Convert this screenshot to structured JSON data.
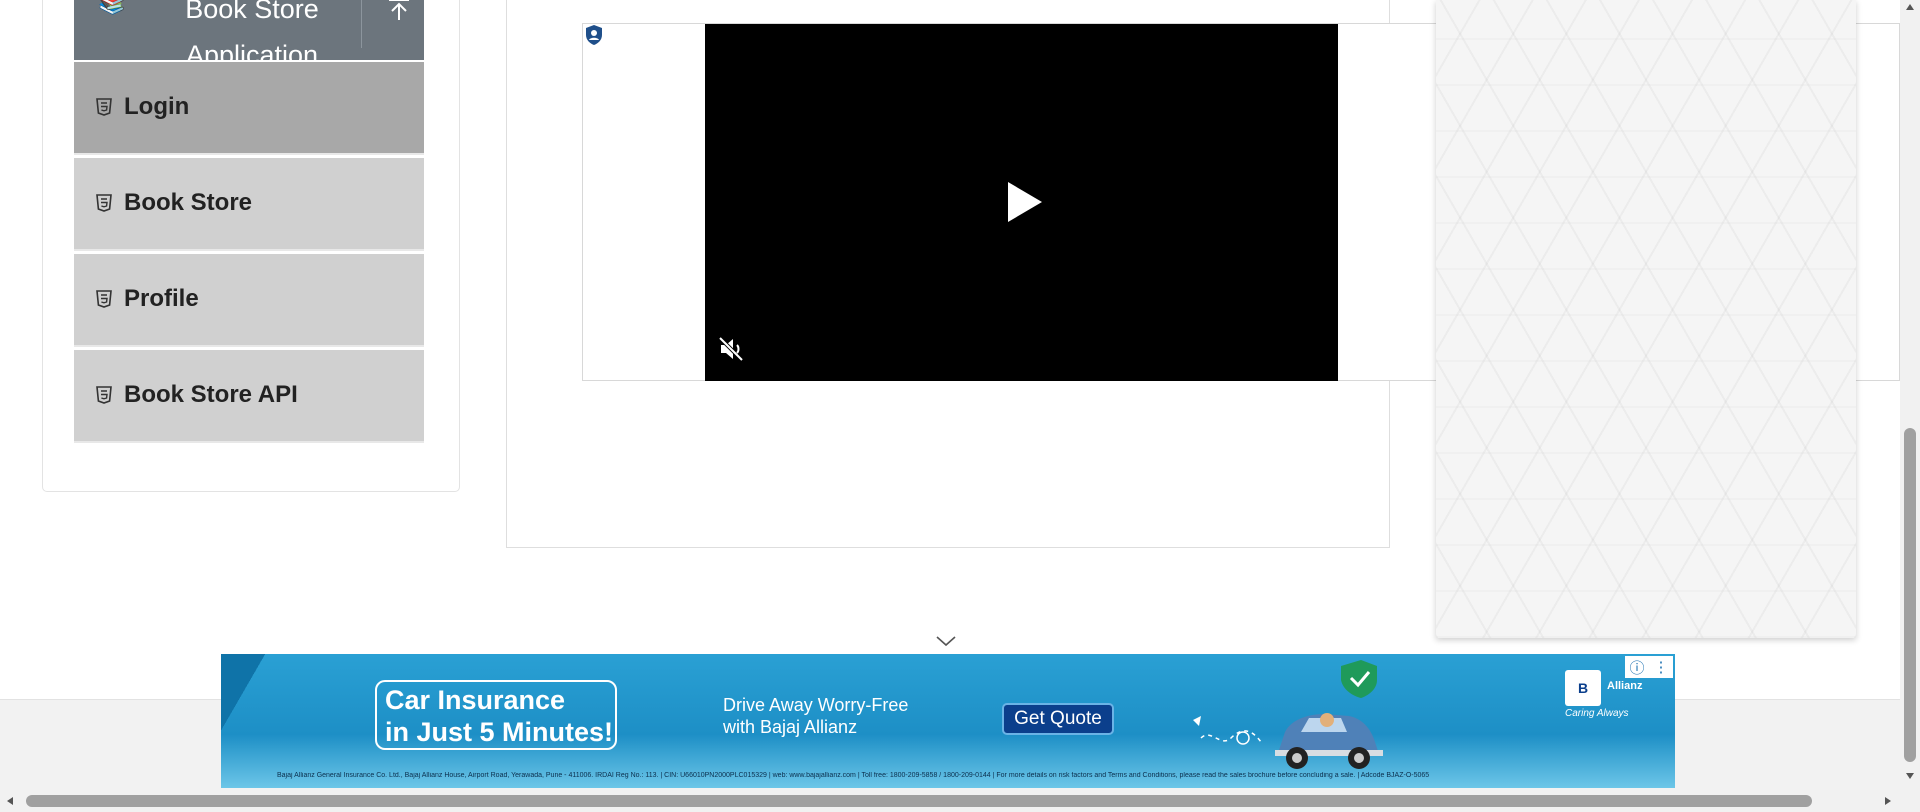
{
  "sidebar": {
    "group": {
      "title": "Book Store\nApplication",
      "icon": "books-icon",
      "collapse_icon": "collapse-up-icon"
    },
    "items": [
      {
        "label": "Login",
        "icon": "html5-icon",
        "active": true
      },
      {
        "label": "Book Store",
        "icon": "html5-icon",
        "active": false
      },
      {
        "label": "Profile",
        "icon": "html5-icon",
        "active": false
      },
      {
        "label": "Book Store API",
        "icon": "html5-icon",
        "active": false
      }
    ]
  },
  "video": {
    "badge_icon": "shield-icon",
    "play_icon": "play-icon",
    "mute_icon": "muted-speaker-icon",
    "muted": true
  },
  "ad": {
    "toggle_icon": "chevron-down-icon",
    "headline": "Car Insurance\nin Just 5 Minutes!",
    "tagline": "Drive Away Worry-Free\nwith Bajaj Allianz",
    "cta": "Get Quote",
    "brand_logo": "B",
    "brand_name": "Allianz",
    "brand_tagline": "Caring Always",
    "disclaimer": "Bajaj Allianz General Insurance Co. Ltd., Bajaj Allianz House, Airport Road, Yerawada, Pune - 411006. IRDAI Reg No.: 113. | CIN: U66010PN2000PLC015329 | web: www.bajajallianz.com | Toll free: 1800-209-5858 / 1800-209-0144 | For more details on risk factors and Terms and Conditions, please read the sales brochure before concluding a sale. | Adcode BJAZ-O-5065",
    "info_icon": "info-icon",
    "menu_icon": "more-vertical-icon",
    "colors": {
      "banner": "#2aa0d4",
      "cta": "#0b3f8c"
    }
  },
  "colors": {
    "sidebar_header": "#6c757d",
    "menu_item": "#d0d0d0",
    "menu_item_active": "#a8a8a8"
  }
}
